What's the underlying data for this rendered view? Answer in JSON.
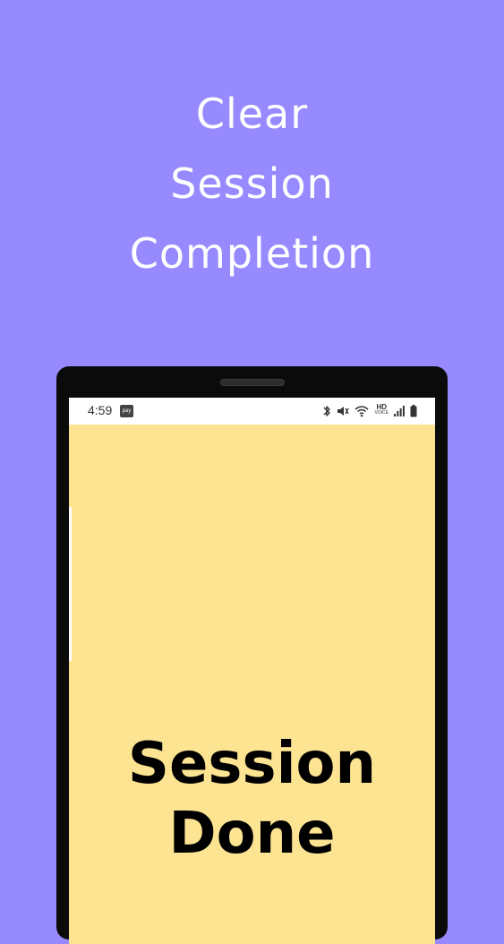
{
  "promo": {
    "headline_lines": [
      "Clear",
      "Session",
      "Completion"
    ]
  },
  "status_bar": {
    "time": "4:59",
    "pay_badge": "pay",
    "icons": [
      "bluetooth-icon",
      "mute-icon",
      "wifi-icon",
      "hd-voice-icon",
      "signal-icon",
      "battery-icon"
    ],
    "hd_label": "HD",
    "voice_label": "VOICE"
  },
  "screen": {
    "message_lines": [
      "Session",
      "Done"
    ]
  },
  "colors": {
    "background": "#968AFE",
    "screen_background": "#FDE492",
    "device_frame": "#0B0B0B",
    "headline_text": "#FFFFFF",
    "message_text": "#000000"
  }
}
